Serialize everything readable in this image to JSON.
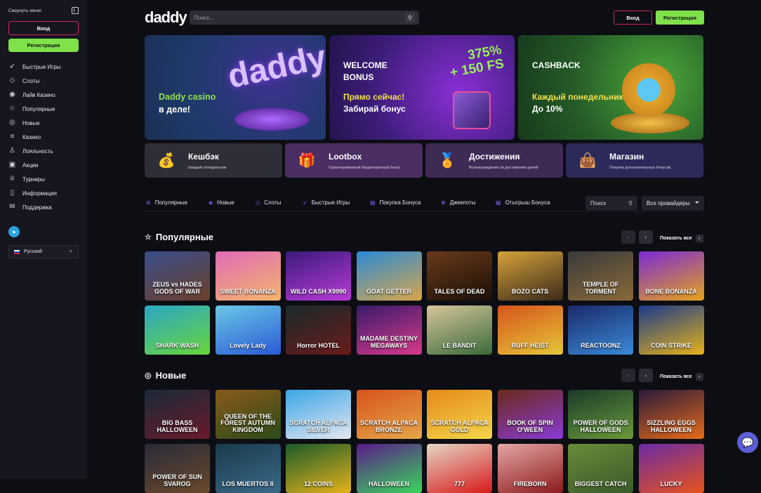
{
  "sidebar": {
    "collapse_label": "Свернуть меню",
    "login": "Вход",
    "register": "Регистрация",
    "items": [
      {
        "label": "Быстрые Игры",
        "icon": "rocket-icon",
        "glyph": "➶"
      },
      {
        "label": "Слоты",
        "icon": "diamond-icon",
        "glyph": "◇"
      },
      {
        "label": "Лайв Казино",
        "icon": "chip-icon",
        "glyph": "◉"
      },
      {
        "label": "Популярные",
        "icon": "star-icon",
        "glyph": "☆"
      },
      {
        "label": "Новые",
        "icon": "new-icon",
        "glyph": "◎"
      },
      {
        "label": "Казино",
        "icon": "coins-icon",
        "glyph": "≡"
      },
      {
        "label": "Лояльность",
        "icon": "medal-icon",
        "glyph": "♙"
      },
      {
        "label": "Акции",
        "icon": "gift-icon",
        "glyph": "▣"
      },
      {
        "label": "Турниры",
        "icon": "trophy-icon",
        "glyph": "♕"
      },
      {
        "label": "Информация",
        "icon": "document-icon",
        "glyph": "▯"
      },
      {
        "label": "Поддержка",
        "icon": "chat-icon",
        "glyph": "✉"
      }
    ],
    "language": "Русский"
  },
  "topbar": {
    "logo": "daddy",
    "search_placeholder": "Поиск...",
    "login": "Вход",
    "register": "Регистрация"
  },
  "banners": [
    {
      "line1": "Daddy casino",
      "line2": "в деле!",
      "art": "daddy"
    },
    {
      "title1": "WELCOME",
      "title2": "BONUS",
      "sub1": "Прямо сейчас!",
      "sub2": "Забирай бонус",
      "art1": "375%",
      "art2": "+ 150 FS"
    },
    {
      "title1": "CASHBACK",
      "sub1": "Каждый понедельник",
      "sub2": "До 10%"
    }
  ],
  "promos": [
    {
      "title": "Кешбэк",
      "sub": "Каждый понедельник",
      "icon": "coin-stack-icon",
      "glyph": "💰"
    },
    {
      "title": "Lootbox",
      "sub": "Гарантированный бездепозитный бонус",
      "icon": "gift-box-icon",
      "glyph": "🎁"
    },
    {
      "title": "Достижения",
      "sub": "Вознаграждение за достижение целей",
      "icon": "medal-icon",
      "glyph": "🏅"
    },
    {
      "title": "Магазин",
      "sub": "Покупка дополнительных бонусов",
      "icon": "shop-bag-icon",
      "glyph": "👜"
    }
  ],
  "categories": [
    {
      "label": "Популярные",
      "icon": "popular-icon",
      "glyph": "⊛"
    },
    {
      "label": "Новые",
      "icon": "new-icon",
      "glyph": "◈"
    },
    {
      "label": "Слоты",
      "icon": "diamond-icon",
      "glyph": "◇"
    },
    {
      "label": "Быстрые Игры",
      "icon": "rocket-icon",
      "glyph": "➶"
    },
    {
      "label": "Покупка Бонуса",
      "icon": "cart-icon",
      "glyph": "▤"
    },
    {
      "label": "Джекпоты",
      "icon": "jackpot-icon",
      "glyph": "⊕"
    },
    {
      "label": "Отыгрыш Бонуса",
      "icon": "wager-icon",
      "glyph": "▤"
    }
  ],
  "category_search": "Поиск",
  "providers": "Все провайдеры",
  "popular": {
    "title": "Популярные",
    "show_all": "Показать все",
    "games": [
      {
        "name": "ZEUS vs HADES GODS OF WAR",
        "color1": "#3a4f8c",
        "color2": "#6a3f2a"
      },
      {
        "name": "SWEET BONANZA",
        "color1": "#e06bb7",
        "color2": "#f3b56b"
      },
      {
        "name": "WILD CASH X9990",
        "color1": "#3a1a7a",
        "color2": "#b93bd8"
      },
      {
        "name": "GOAT GETTER",
        "color1": "#2a8ad6",
        "color2": "#d9a64a"
      },
      {
        "name": "TALES OF DEAD",
        "color1": "#6a3a1a",
        "color2": "#1a0f08"
      },
      {
        "name": "BOZO CATS",
        "color1": "#d6a23a",
        "color2": "#3a2a1a"
      },
      {
        "name": "TEMPLE OF TORMENT",
        "color1": "#3a3a3a",
        "color2": "#8a6a3a"
      },
      {
        "name": "BONE BONANZA",
        "color1": "#7a2ad6",
        "color2": "#e6a21a"
      },
      {
        "name": "SHARK WASH",
        "color1": "#2aa6c6",
        "color2": "#6ad63a"
      },
      {
        "name": "Lovely Lady",
        "color1": "#6ac8e6",
        "color2": "#2a5ad6"
      },
      {
        "name": "Horror HOTEL",
        "color1": "#1a2a2a",
        "color2": "#6a1a1a"
      },
      {
        "name": "MADAME DESTINY MEGAWAYS",
        "color1": "#3a1a6a",
        "color2": "#d63a8a"
      },
      {
        "name": "LE BANDIT",
        "color1": "#d6c69a",
        "color2": "#3a6a3a"
      },
      {
        "name": "RUFF HEIST",
        "color1": "#d6541a",
        "color2": "#e6c63a"
      },
      {
        "name": "REACTOONZ",
        "color1": "#1a2a6a",
        "color2": "#3a8ad6"
      },
      {
        "name": "COIN STRIKE",
        "color1": "#1a3a8a",
        "color2": "#e6b21a"
      }
    ]
  },
  "new_games": {
    "title": "Новые",
    "show_all": "Показать все",
    "games": [
      {
        "name": "BIG BASS HALLOWEEN",
        "color1": "#1a2a3a",
        "color2": "#6a1a2a"
      },
      {
        "name": "QUEEN OF THE FOREST AUTUMN KINGDOM",
        "color1": "#8a5a1a",
        "color2": "#2a4a1a"
      },
      {
        "name": "SCRATCH ALPACA SILVER",
        "color1": "#3aa6e6",
        "color2": "#e6e6f0"
      },
      {
        "name": "SCRATCH ALPACA BRONZE",
        "color1": "#d6541a",
        "color2": "#e6a64a"
      },
      {
        "name": "SCRATCH ALPACA GOLD",
        "color1": "#e68a1a",
        "color2": "#f3d64a"
      },
      {
        "name": "BOOK OF SPIN O'WEEN",
        "color1": "#6a2a1a",
        "color2": "#8a3ad6"
      },
      {
        "name": "POWER OF GODS HALLOWEEN",
        "color1": "#1a3a2a",
        "color2": "#6a9a3a"
      },
      {
        "name": "SIZZLING EGGS HALLOWEEN",
        "color1": "#2a1a3a",
        "color2": "#e66a1a"
      },
      {
        "name": "POWER OF SUN SVAROG",
        "color1": "#2a2a3a",
        "color2": "#6a4a2a"
      },
      {
        "name": "LOS MUERTOS II",
        "color1": "#1a3a4a",
        "color2": "#3a6a8a"
      },
      {
        "name": "12 COINS",
        "color1": "#1a5a2a",
        "color2": "#e6b21a"
      },
      {
        "name": "HALLOWEEN",
        "color1": "#5a1a8a",
        "color2": "#3ad65a"
      },
      {
        "name": "777",
        "color1": "#e6d6c6",
        "color2": "#d61a1a"
      },
      {
        "name": "FIREBORN",
        "color1": "#e6a6a6",
        "color2": "#8a1a1a"
      },
      {
        "name": "BIGGEST CATCH",
        "color1": "#6a8a3a",
        "color2": "#3a5a2a"
      },
      {
        "name": "LUCKY",
        "color1": "#6a2aa6",
        "color2": "#e6541a"
      }
    ]
  },
  "colors": {
    "accent_green": "#7fe24a",
    "accent_pink": "#d1245e",
    "brand_purple": "#8b3df0"
  }
}
